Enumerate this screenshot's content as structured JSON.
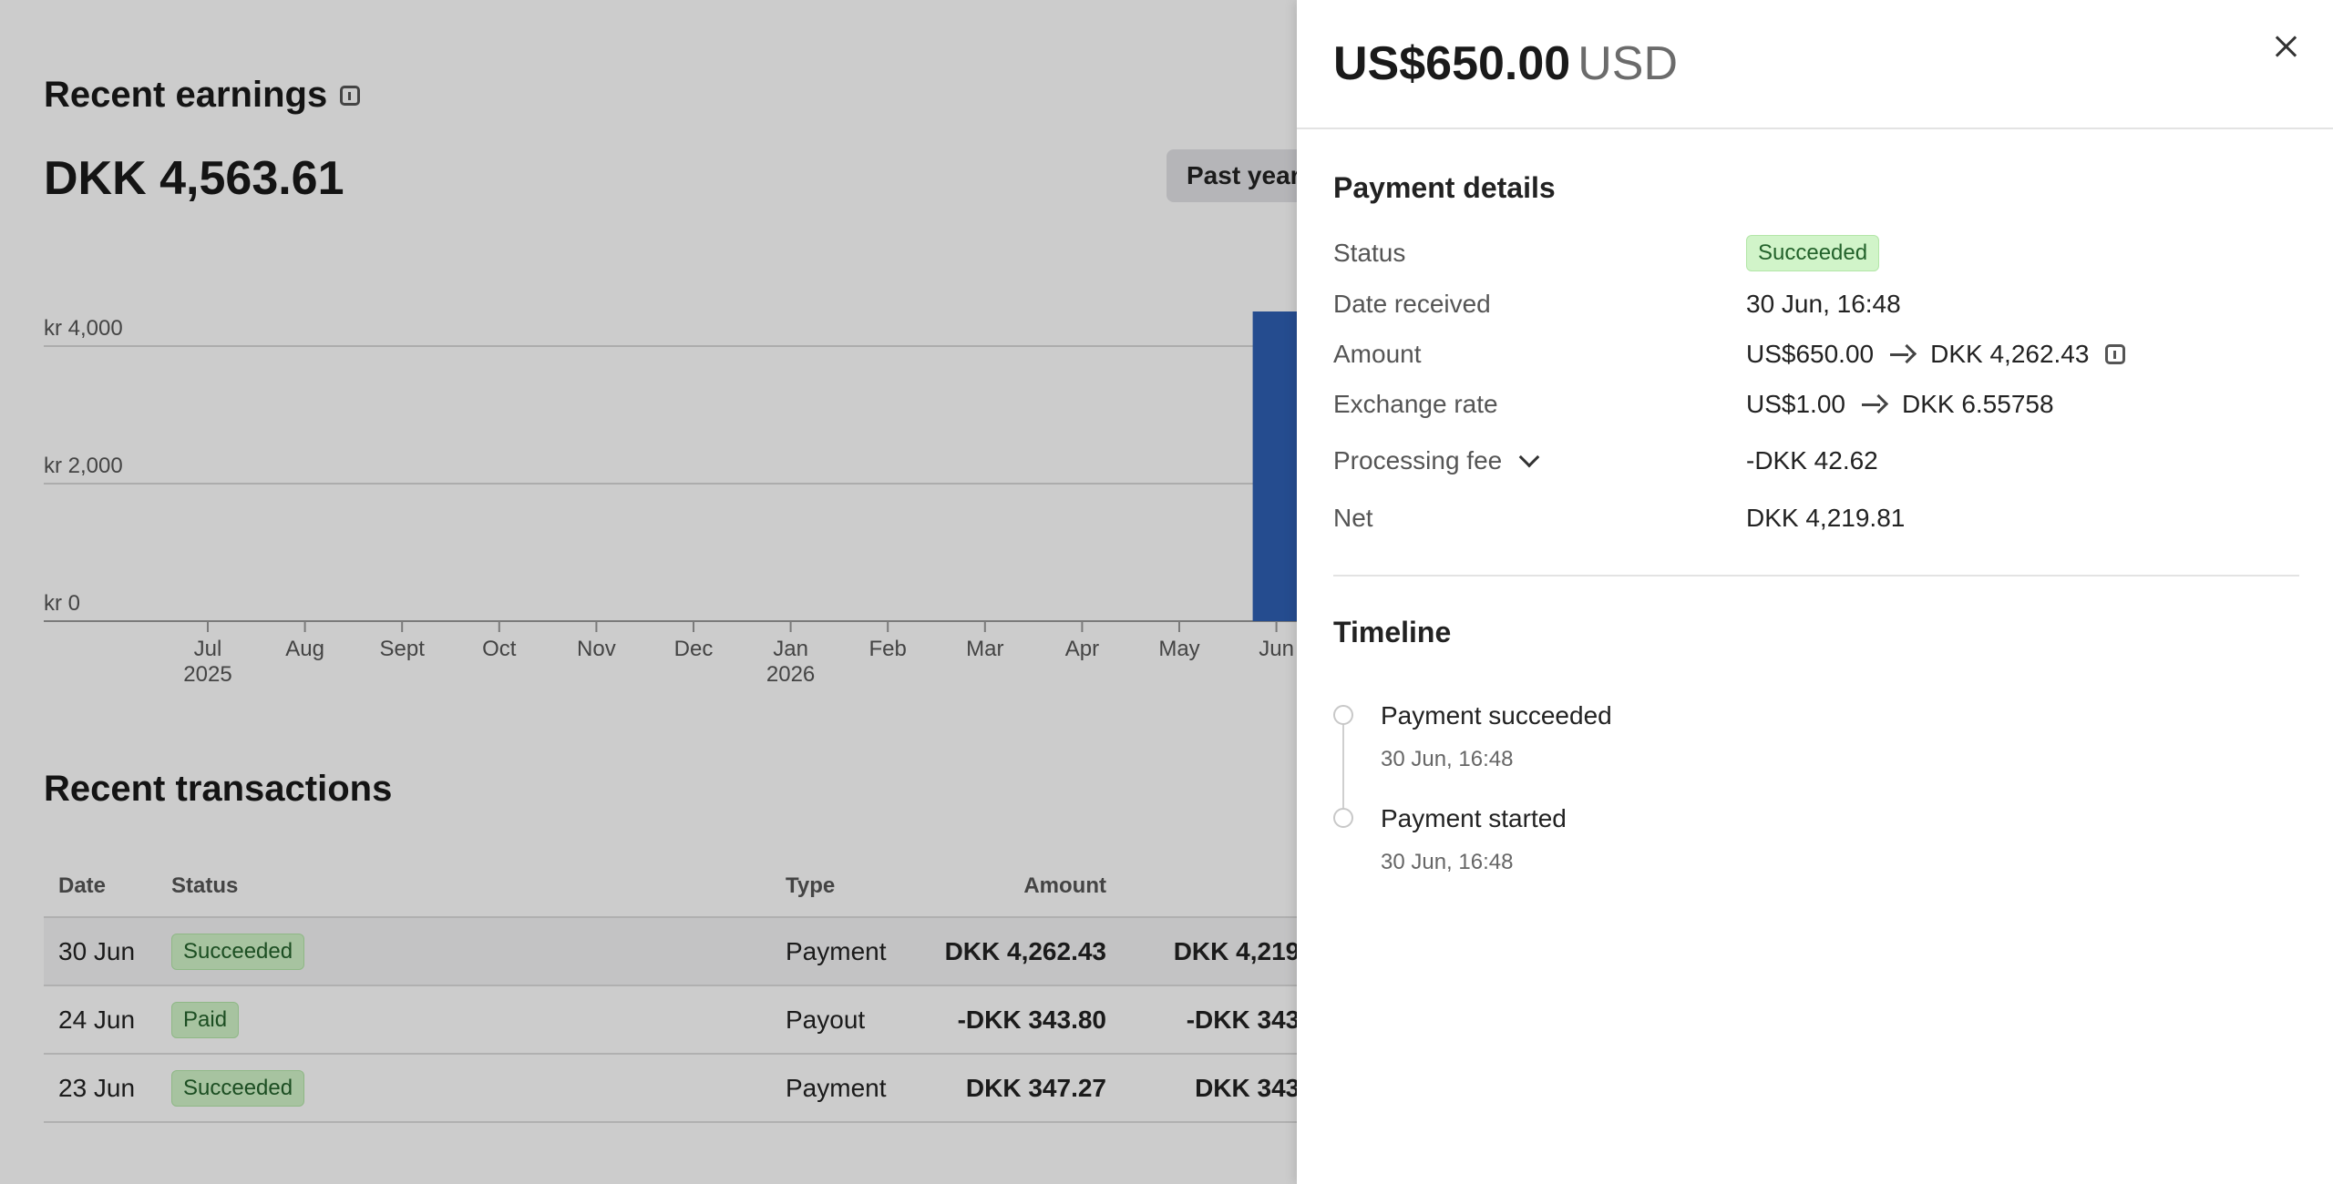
{
  "earnings": {
    "title": "Recent earnings",
    "total": "DKK 4,563.61",
    "range_label": "Past year"
  },
  "chart_data": {
    "type": "bar",
    "categories": [
      "Jul",
      "Aug",
      "Sept",
      "Oct",
      "Nov",
      "Dec",
      "Jan",
      "Feb",
      "Mar",
      "Apr",
      "May",
      "Jun"
    ],
    "year_labels": [
      {
        "category": "Jul",
        "year": "2025"
      },
      {
        "category": "Jan",
        "year": "2026"
      }
    ],
    "values": [
      0,
      0,
      0,
      0,
      0,
      0,
      0,
      0,
      0,
      0,
      0,
      4563.61
    ],
    "y_ticks": [
      "kr 4,000",
      "kr 2,000",
      "kr 0"
    ],
    "y_tick_values": [
      4000,
      2000,
      0
    ],
    "ylim": [
      0,
      4000
    ],
    "bar_color": "#2f5fb3",
    "grid": true
  },
  "transactions": {
    "title": "Recent transactions",
    "columns": [
      "Date",
      "Status",
      "Type",
      "Amount"
    ],
    "rows": [
      {
        "date": "30 Jun",
        "status": "Succeeded",
        "type": "Payment",
        "amount": "DKK 4,262.43",
        "net": "DKK 4,219."
      },
      {
        "date": "24 Jun",
        "status": "Paid",
        "type": "Payout",
        "amount": "-DKK 343.80",
        "net": "-DKK 343."
      },
      {
        "date": "23 Jun",
        "status": "Succeeded",
        "type": "Payment",
        "amount": "DKK 347.27",
        "net": "DKK 343."
      }
    ]
  },
  "drawer": {
    "amount": "US$650.00",
    "currency": "USD",
    "details_title": "Payment details",
    "status_label": "Status",
    "status_value": "Succeeded",
    "date_label": "Date received",
    "date_value": "30 Jun, 16:48",
    "amount_label": "Amount",
    "amount_from": "US$650.00",
    "amount_to": "DKK 4,262.43",
    "rate_label": "Exchange rate",
    "rate_from": "US$1.00",
    "rate_to": "DKK 6.55758",
    "fee_label": "Processing fee",
    "fee_value": "-DKK 42.62",
    "net_label": "Net",
    "net_value": "DKK 4,219.81",
    "timeline_title": "Timeline",
    "timeline": [
      {
        "event": "Payment succeeded",
        "time": "30 Jun, 16:48"
      },
      {
        "event": "Payment started",
        "time": "30 Jun, 16:48"
      }
    ]
  },
  "colors": {
    "accent_bar": "#2f5fb3",
    "success_bg": "#d1f4c9",
    "success_text": "#23622b"
  }
}
